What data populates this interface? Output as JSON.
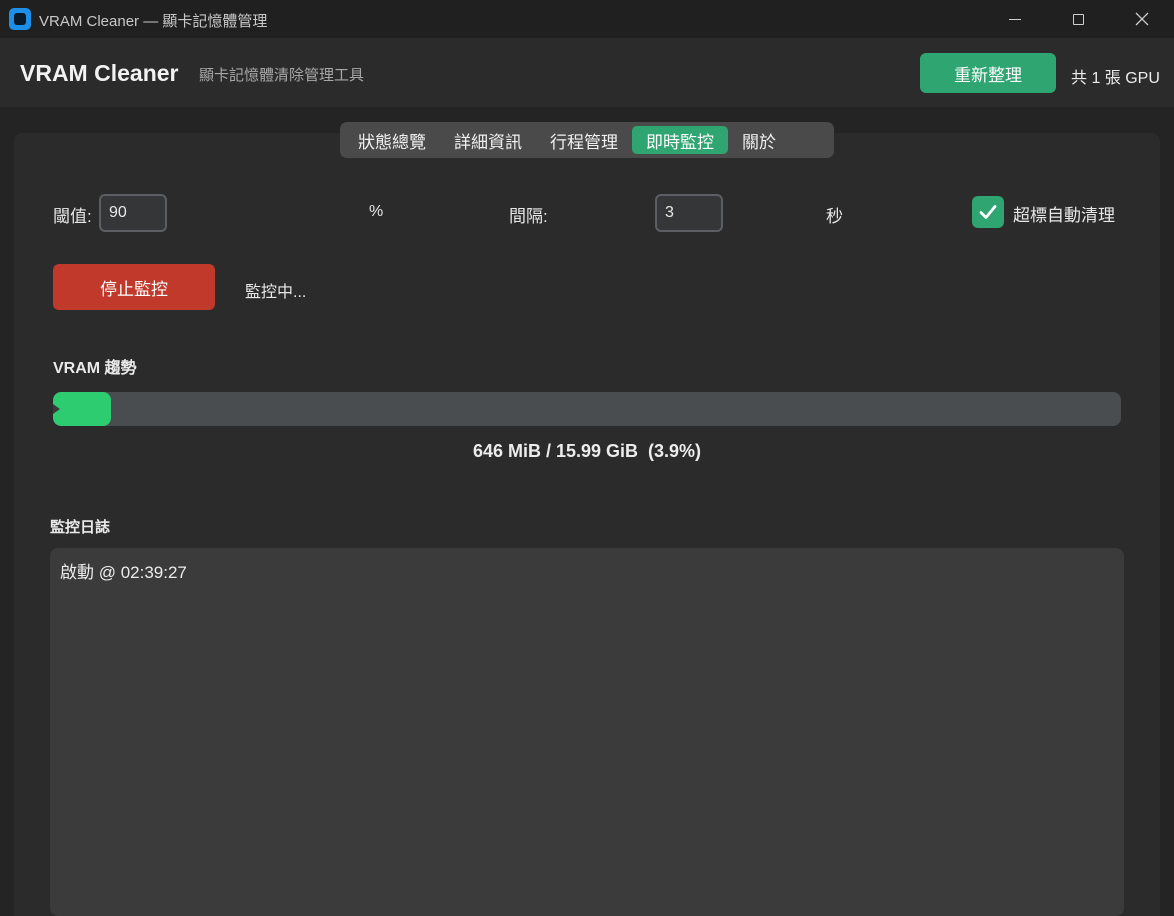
{
  "window": {
    "title": "VRAM Cleaner — 顯卡記憶體管理"
  },
  "header": {
    "app_name": "VRAM Cleaner",
    "subtitle": "顯卡記憶體清除管理工具",
    "refresh_label": "重新整理",
    "gpu_count": "共 1 張 GPU"
  },
  "tabs": [
    {
      "label": "狀態總覽",
      "active": false
    },
    {
      "label": "詳細資訊",
      "active": false
    },
    {
      "label": "行程管理",
      "active": false
    },
    {
      "label": "即時監控",
      "active": true
    },
    {
      "label": "關於",
      "active": false
    }
  ],
  "monitor": {
    "threshold_label": "閾值:",
    "threshold_value": "90",
    "threshold_unit": "%",
    "interval_label": "間隔:",
    "interval_value": "3",
    "interval_unit": "秒",
    "auto_clean_label": "超標自動清理",
    "auto_clean_checked": true,
    "stop_label": "停止監控",
    "status_text": "監控中..."
  },
  "trend": {
    "title": "VRAM 趨勢",
    "usage_fraction": 0.039,
    "usage_text": "646 MiB / 15.99 GiB  (3.9%)"
  },
  "log": {
    "title": "監控日誌",
    "lines": [
      "啟動 @ 02:39:27"
    ]
  },
  "colors": {
    "accent": "#2fa572",
    "danger": "#c0392b",
    "progress": "#2ecc71"
  }
}
